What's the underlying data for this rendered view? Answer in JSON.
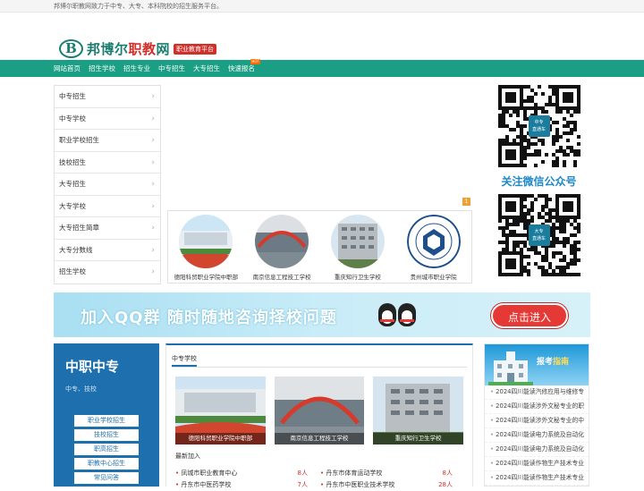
{
  "topbar": {
    "text": "邦博尔职教网致力于中专、大专、本科院校的招生服务平台。"
  },
  "logo": {
    "mark": "B",
    "text_a": "邦博尔",
    "text_b": "职教",
    "text_c": "网",
    "tag": "职业教育平台"
  },
  "nav": {
    "items": [
      "网站首页",
      "招生学校",
      "招生专业",
      "中专招生",
      "大专招生",
      "快速报名"
    ],
    "hot_label": "HOT"
  },
  "left_menu": [
    "中专招生",
    "中专学校",
    "职业学校招生",
    "技校招生",
    "大专招生",
    "大专学校",
    "大专招生简章",
    "大专分数线",
    "招生学校"
  ],
  "ad_badge": "1",
  "schools": [
    "德阳科贸职业学院中职部",
    "南京信息工程技工学校",
    "重庆知行卫生学校",
    "贵州城市职业学院"
  ],
  "qr": {
    "top_label": "中专\n直通车",
    "follow_text": "关注微信公众号",
    "bottom_label": "大专\n直通车"
  },
  "banner": {
    "text": "加入QQ群  随时随地咨询择校问题",
    "button": "点击进入"
  },
  "low_left": {
    "heading": "中职中专",
    "sub": "中专、技校",
    "links": [
      "职业学校招生",
      "技校招生",
      "职高招生",
      "职教中心招生",
      "常见问答"
    ]
  },
  "center": {
    "tab": "中专学校",
    "photos": [
      "德阳科贸职业学院中职部",
      "南京信息工程技工学校",
      "重庆知行卫生学校"
    ],
    "new_join": "最新加入",
    "rows": [
      [
        {
          "name": "凤城市职业教育中心",
          "count": "8人"
        },
        {
          "name": "丹东市体育运动学校",
          "count": "8人"
        }
      ],
      [
        {
          "name": "丹东市中医药学校",
          "count": "7人"
        },
        {
          "name": "丹东市中医职业技术学校",
          "count": "28人"
        }
      ]
    ]
  },
  "right_low": {
    "banner_a": "报考",
    "banner_b": "指南",
    "items": [
      "2024四川能读汽修应用与维修专",
      "2024四川能读涉外文秘专业的职",
      "2024四川能读涉外文秘专业的中",
      "2024四川能读电力系统及自动化",
      "2024四川能读电力系统及自动化",
      "2024四川能读作物生产技术专业",
      "2024四川能读作物生产技术专业"
    ]
  },
  "colors": {
    "nav": "#1a9e84",
    "brand_blue": "#1e6fad",
    "accent_red": "#d0302a"
  }
}
